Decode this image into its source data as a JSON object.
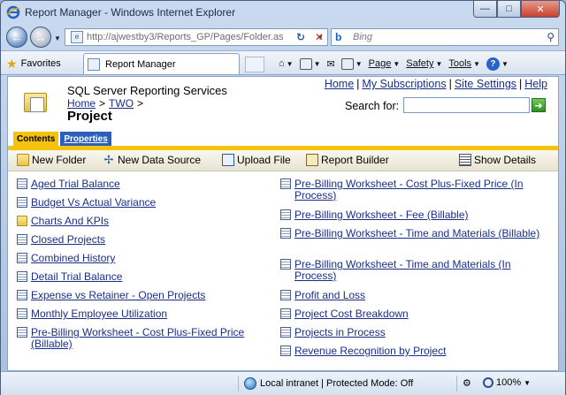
{
  "window": {
    "title": "Report Manager - Windows Internet Explorer",
    "minimize": "—",
    "restore": "□",
    "close": "✕"
  },
  "address": {
    "url": "http://ajwestby3/Reports_GP/Pages/Folder.as",
    "search_placeholder": "Bing"
  },
  "commandbar": {
    "favorites_label": "Favorites",
    "tab_title": "Report Manager",
    "page_label": "Page",
    "safety_label": "Safety",
    "tools_label": "Tools"
  },
  "header": {
    "product": "SQL Server Reporting Services",
    "breadcrumb": [
      "Home",
      ">",
      "TWO",
      ">"
    ],
    "title": "Project",
    "links": [
      "Home",
      "My Subscriptions",
      "Site Settings",
      "Help"
    ],
    "search_label": "Search for:"
  },
  "tabs": {
    "contents": "Contents",
    "properties": "Properties"
  },
  "toolbar": {
    "new_folder": "New Folder",
    "new_data_source": "New Data Source",
    "upload_file": "Upload File",
    "report_builder": "Report Builder",
    "show_details": "Show Details"
  },
  "items_left": [
    {
      "type": "report",
      "label": "Aged Trial Balance"
    },
    {
      "type": "report",
      "label": "Budget Vs Actual Variance"
    },
    {
      "type": "folder",
      "label": "Charts And KPIs"
    },
    {
      "type": "report",
      "label": "Closed Projects"
    },
    {
      "type": "report",
      "label": "Combined History"
    },
    {
      "type": "report",
      "label": "Detail Trial Balance"
    },
    {
      "type": "report",
      "label": "Expense vs Retainer - Open Projects"
    },
    {
      "type": "report",
      "label": "Monthly Employee Utilization"
    },
    {
      "type": "report",
      "label": "Pre-Billing Worksheet - Cost Plus-Fixed Price (Billable)"
    }
  ],
  "items_right": [
    {
      "type": "report",
      "label": "Pre-Billing Worksheet - Cost Plus-Fixed Price (In Process)"
    },
    {
      "type": "report",
      "label": "Pre-Billing Worksheet - Fee (Billable)"
    },
    {
      "type": "report",
      "label": "Pre-Billing Worksheet - Time and Materials (Billable)"
    },
    {
      "type": "report",
      "label": "Pre-Billing Worksheet - Time and Materials (In Process)"
    },
    {
      "type": "report",
      "label": "Profit and Loss"
    },
    {
      "type": "report",
      "label": "Project Cost Breakdown"
    },
    {
      "type": "report",
      "label": "Projects in Process"
    },
    {
      "type": "report",
      "label": "Revenue Recognition by Project"
    }
  ],
  "status": {
    "zone": "Local intranet | Protected Mode: Off",
    "zoom": "100%"
  },
  "colors": {
    "link": "#1a2e87",
    "tab_active": "#f5c20d",
    "tab_inactive": "#2c5fb9"
  }
}
